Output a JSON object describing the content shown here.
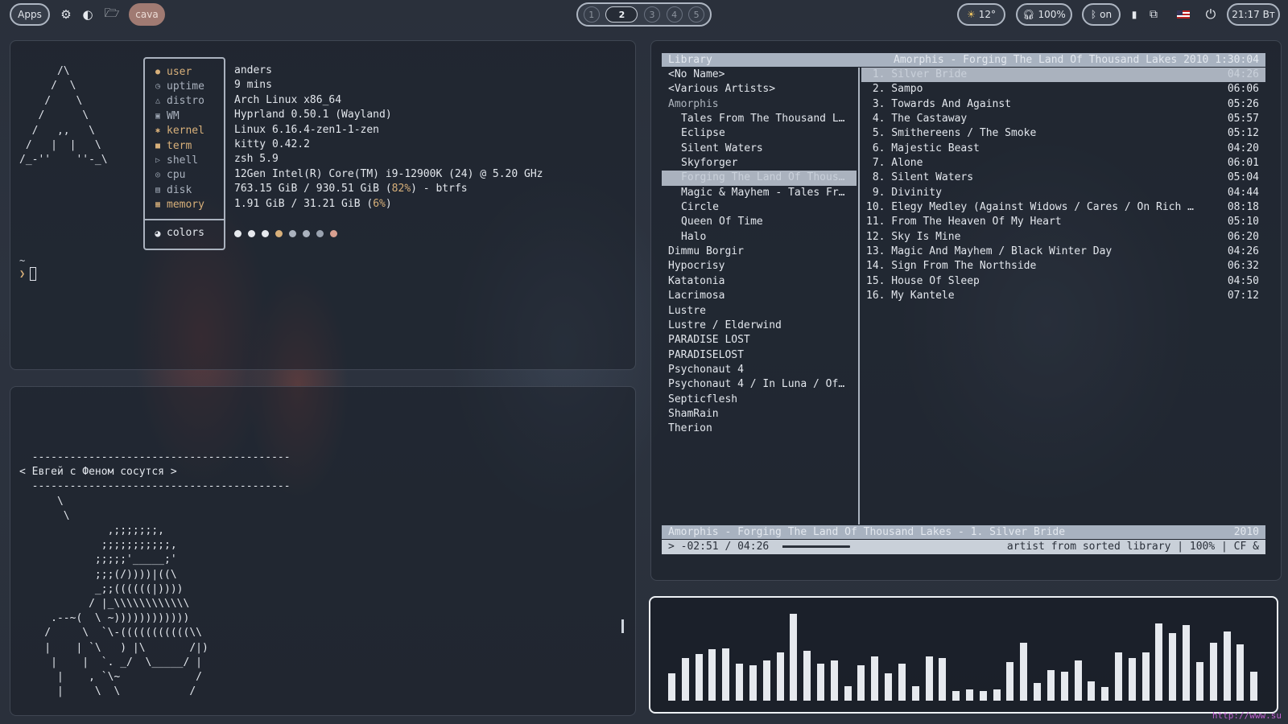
{
  "topbar": {
    "apps_label": "Apps",
    "active_app": "cava",
    "workspaces": [
      "1",
      "2",
      "3",
      "4",
      "5"
    ],
    "active_workspace": "2",
    "weather": "12°",
    "volume": "100%",
    "bluetooth": "on",
    "clock": "21:17 Вт"
  },
  "fetch": {
    "logo": "      /\\\n     /  \\\n    /    \\\n   /      \\\n  /   ,,   \\\n /   |  |   \\\n/_-''    ''-_\\",
    "rows": [
      {
        "icon": "user-icon",
        "glyph": "●",
        "key": "user",
        "value": "anders",
        "hl": true
      },
      {
        "icon": "clock-icon",
        "glyph": "◷",
        "key": "uptime",
        "value": "9 mins"
      },
      {
        "icon": "distro-icon",
        "glyph": "△",
        "key": "distro",
        "value": "Arch Linux x86_64"
      },
      {
        "icon": "monitor-icon",
        "glyph": "▣",
        "key": "WM",
        "value": "Hyprland 0.50.1 (Wayland)"
      },
      {
        "icon": "gear-icon",
        "glyph": "✱",
        "key": "kernel",
        "value": "Linux 6.16.4-zen1-1-zen",
        "hl": true
      },
      {
        "icon": "terminal-icon",
        "glyph": "■",
        "key": "term",
        "value": "kitty 0.42.2",
        "hl": true
      },
      {
        "icon": "shell-icon",
        "glyph": "▷",
        "key": "shell",
        "value": "zsh 5.9"
      },
      {
        "icon": "cpu-icon",
        "glyph": "◎",
        "key": "cpu",
        "value": "12Gen Intel(R) Core(TM) i9-12900K (24) @ 5.20 GHz"
      },
      {
        "icon": "disk-icon",
        "glyph": "▤",
        "key": "disk",
        "value_pre": "763.15 GiB / 930.51 GiB (",
        "value_hl": "82%",
        "value_post": ") - btrfs"
      },
      {
        "icon": "memory-icon",
        "glyph": "▦",
        "key": "memory",
        "value_pre": "1.91 GiB / 31.21 GiB (",
        "value_hl": "6%",
        "value_post": ")",
        "hl": true
      }
    ],
    "colors_label": "colors",
    "palette": [
      "#e6e9ee",
      "#e6e9ee",
      "#e6e9ee",
      "#d8b07a",
      "#aab2be",
      "#aab2be",
      "#9aa3b0",
      "#d8a090"
    ],
    "prompt_line1": "~",
    "prompt_symbol": "❯"
  },
  "cowsay": "  -----------------------------------------\n< Евгей с Феном сосутся >\n  -----------------------------------------\n      \\\n       \\\n              ,;;;;;;;,\n             ;;;;;;;;;;;,\n            ;;;;;'_____;'\n            ;;;(/))))|((\\\n            _;;((((((|))))\n           / |_\\\\\\\\\\\\\\\\\\\\\\\\\n     .--~(  \\ ~))))))))))))\n    /     \\  `\\-(((((((((((\\\\\n    |    | `\\   ) |\\       /|)\n     |    |  `. _/  \\_____/ |\n      |    , `\\~            /\n      |     \\  \\           /",
  "mpd": {
    "header_left": "Library",
    "header_right": "Amorphis - Forging The Land Of Thousand Lakes 2010 1:30:04",
    "artists": [
      {
        "name": "<No Name>"
      },
      {
        "name": "<Various Artists>"
      },
      {
        "name": "Amorphis",
        "group": true
      },
      {
        "name": "Tales From The Thousand L…",
        "sub": true
      },
      {
        "name": "Eclipse",
        "sub": true
      },
      {
        "name": "Silent Waters",
        "sub": true
      },
      {
        "name": "Skyforger",
        "sub": true
      },
      {
        "name": "Forging The Land Of Thous…",
        "sub": true,
        "sel": true
      },
      {
        "name": "Magic & Mayhem - Tales Fr…",
        "sub": true
      },
      {
        "name": "Circle",
        "sub": true
      },
      {
        "name": "Queen Of Time",
        "sub": true
      },
      {
        "name": "Halo",
        "sub": true
      },
      {
        "name": "Dimmu Borgir"
      },
      {
        "name": "Hypocrisy"
      },
      {
        "name": "Katatonia"
      },
      {
        "name": "Lacrimosa"
      },
      {
        "name": "Lustre"
      },
      {
        "name": "Lustre / Elderwind"
      },
      {
        "name": "PARADISE LOST"
      },
      {
        "name": "PARADISELOST"
      },
      {
        "name": "Psychonaut 4"
      },
      {
        "name": "Psychonaut 4 / In Luna / Of…"
      },
      {
        "name": "Septicflesh"
      },
      {
        "name": "ShamRain"
      },
      {
        "name": "Therion"
      }
    ],
    "tracks": [
      {
        "n": " 1. Silver Bride",
        "d": "04:26",
        "sel": true
      },
      {
        "n": " 2. Sampo",
        "d": "06:06"
      },
      {
        "n": " 3. Towards And Against",
        "d": "05:26"
      },
      {
        "n": " 4. The Castaway",
        "d": "05:57"
      },
      {
        "n": " 5. Smithereens / The Smoke",
        "d": "05:12"
      },
      {
        "n": " 6. Majestic Beast",
        "d": "04:20"
      },
      {
        "n": " 7. Alone",
        "d": "06:01"
      },
      {
        "n": " 8. Silent Waters",
        "d": "05:04"
      },
      {
        "n": " 9. Divinity",
        "d": "04:44"
      },
      {
        "n": "10. Elegy Medley (Against Widows / Cares / On Rich …",
        "d": "08:18"
      },
      {
        "n": "11. From The Heaven Of My Heart",
        "d": "05:10"
      },
      {
        "n": "12. Sky Is Mine",
        "d": "06:20"
      },
      {
        "n": "13. Magic And Mayhem / Black Winter Day",
        "d": "04:26"
      },
      {
        "n": "14. Sign From The Northside",
        "d": "06:32"
      },
      {
        "n": "15. House Of Sleep",
        "d": "04:50"
      },
      {
        "n": "16. My Kantele",
        "d": "07:12"
      }
    ],
    "now_playing_left": "Amorphis - Forging The Land Of Thousand Lakes - 1. Silver Bride",
    "now_playing_right": "2010",
    "status_left": "> -02:51 / 04:26",
    "status_right": "artist from sorted library | 100% | CF &",
    "progress_fraction": 0.35
  },
  "cava_levels": [
    0.28,
    0.44,
    0.48,
    0.53,
    0.54,
    0.38,
    0.37,
    0.42,
    0.5,
    0.9,
    0.52,
    0.38,
    0.42,
    0.15,
    0.37,
    0.46,
    0.28,
    0.38,
    0.15,
    0.46,
    0.44,
    0.1,
    0.12,
    0.1,
    0.12,
    0.4,
    0.6,
    0.18,
    0.32,
    0.3,
    0.42,
    0.2,
    0.14,
    0.5,
    0.44,
    0.5,
    0.8,
    0.7,
    0.78,
    0.4,
    0.6,
    0.72,
    0.58,
    0.3
  ],
  "watermark": "http://www.su"
}
